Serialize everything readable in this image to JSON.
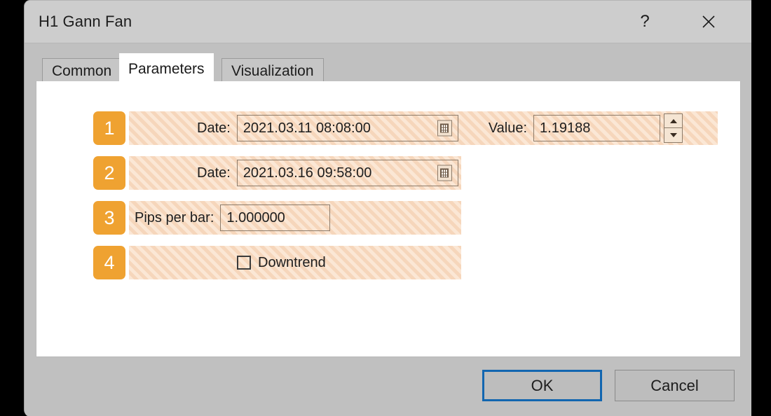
{
  "window": {
    "title": "H1 Gann Fan",
    "help_icon": "question-mark-icon",
    "close_icon": "close-icon"
  },
  "tabs": [
    {
      "label": "Common",
      "active": false
    },
    {
      "label": "Parameters",
      "active": true
    },
    {
      "label": "Visualization",
      "active": false
    }
  ],
  "parameters": {
    "rows": [
      {
        "badge": "1",
        "label": "Date:",
        "value": "2021.03.11 08:08:00",
        "secondary_label": "Value:",
        "secondary_value": "1.19188",
        "calendar_icon": "calendar-icon",
        "spinner_up_icon": "arrow-up-icon",
        "spinner_down_icon": "arrow-down-icon"
      },
      {
        "badge": "2",
        "label": "Date:",
        "value": "2021.03.16 09:58:00",
        "calendar_icon": "calendar-icon"
      },
      {
        "badge": "3",
        "label": "Pips per bar:",
        "value": "1.000000"
      },
      {
        "badge": "4",
        "label": "Downtrend",
        "checked": false
      }
    ]
  },
  "footer": {
    "ok_label": "OK",
    "cancel_label": "Cancel"
  },
  "colors": {
    "badge_orange": "#efa231",
    "field_hatch_base": "#fbe7d5",
    "field_hatch_stripe": "#f6d6bb",
    "focus_blue": "#1266b0",
    "dialog_gray": "#c0c0c0",
    "titlebar_gray": "#cdcdcd",
    "panel_white": "#ffffff"
  }
}
